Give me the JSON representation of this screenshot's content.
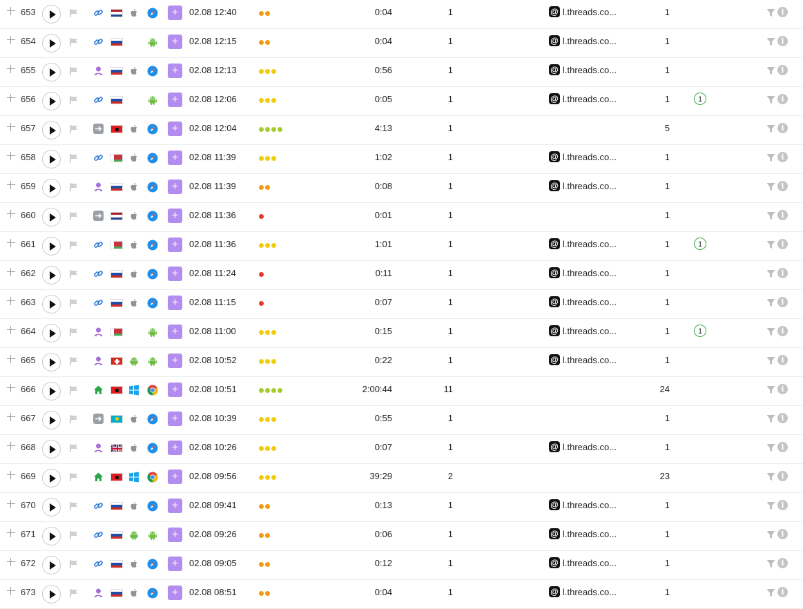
{
  "colors": {
    "accent": "#b28cf0",
    "link": "#2a78d6",
    "android": "#6ebc45",
    "green": "#3bab48"
  },
  "rows": [
    {
      "num": "653",
      "src": "link",
      "country": "nl",
      "os": "apple",
      "browser": "safari",
      "datetime": "02.08 12:40",
      "dots": [
        "orange",
        "orange"
      ],
      "duration": "0:04",
      "pages": "1",
      "referrer": "l.threads.co...",
      "events": "1",
      "badge": ""
    },
    {
      "num": "654",
      "src": "link",
      "country": "ru",
      "os": "none",
      "browser": "android",
      "datetime": "02.08 12:15",
      "dots": [
        "orange",
        "orange"
      ],
      "duration": "0:04",
      "pages": "1",
      "referrer": "l.threads.co...",
      "events": "1",
      "badge": ""
    },
    {
      "num": "655",
      "src": "user",
      "country": "ru",
      "os": "apple",
      "browser": "safari",
      "datetime": "02.08 12:13",
      "dots": [
        "yellow",
        "yellow",
        "yellow"
      ],
      "duration": "0:56",
      "pages": "1",
      "referrer": "l.threads.co...",
      "events": "1",
      "badge": ""
    },
    {
      "num": "656",
      "src": "link",
      "country": "ru",
      "os": "none",
      "browser": "android",
      "datetime": "02.08 12:06",
      "dots": [
        "yellow",
        "yellow",
        "yellow"
      ],
      "duration": "0:05",
      "pages": "1",
      "referrer": "l.threads.co...",
      "events": "1",
      "badge": "1"
    },
    {
      "num": "657",
      "src": "arrow",
      "country": "al",
      "os": "apple",
      "browser": "safari",
      "datetime": "02.08 12:04",
      "dots": [
        "lime",
        "lime",
        "lime",
        "lime"
      ],
      "duration": "4:13",
      "pages": "1",
      "referrer": "",
      "events": "5",
      "badge": ""
    },
    {
      "num": "658",
      "src": "link",
      "country": "by",
      "os": "apple",
      "browser": "safari",
      "datetime": "02.08 11:39",
      "dots": [
        "yellow",
        "yellow",
        "yellow"
      ],
      "duration": "1:02",
      "pages": "1",
      "referrer": "l.threads.co...",
      "events": "1",
      "badge": ""
    },
    {
      "num": "659",
      "src": "user",
      "country": "ru",
      "os": "apple",
      "browser": "safari",
      "datetime": "02.08 11:39",
      "dots": [
        "orange",
        "orange"
      ],
      "duration": "0:08",
      "pages": "1",
      "referrer": "l.threads.co...",
      "events": "1",
      "badge": ""
    },
    {
      "num": "660",
      "src": "arrow",
      "country": "nl",
      "os": "apple",
      "browser": "safari",
      "datetime": "02.08 11:36",
      "dots": [
        "red"
      ],
      "duration": "0:01",
      "pages": "1",
      "referrer": "",
      "events": "1",
      "badge": ""
    },
    {
      "num": "661",
      "src": "link",
      "country": "by",
      "os": "apple",
      "browser": "safari",
      "datetime": "02.08 11:36",
      "dots": [
        "yellow",
        "yellow",
        "yellow"
      ],
      "duration": "1:01",
      "pages": "1",
      "referrer": "l.threads.co...",
      "events": "1",
      "badge": "1"
    },
    {
      "num": "662",
      "src": "link",
      "country": "ru",
      "os": "apple",
      "browser": "safari",
      "datetime": "02.08 11:24",
      "dots": [
        "red"
      ],
      "duration": "0:11",
      "pages": "1",
      "referrer": "l.threads.co...",
      "events": "1",
      "badge": ""
    },
    {
      "num": "663",
      "src": "link",
      "country": "ru",
      "os": "apple",
      "browser": "safari",
      "datetime": "02.08 11:15",
      "dots": [
        "red"
      ],
      "duration": "0:07",
      "pages": "1",
      "referrer": "l.threads.co...",
      "events": "1",
      "badge": ""
    },
    {
      "num": "664",
      "src": "user",
      "country": "by",
      "os": "none",
      "browser": "android",
      "datetime": "02.08 11:00",
      "dots": [
        "yellow",
        "yellow",
        "yellow"
      ],
      "duration": "0:15",
      "pages": "1",
      "referrer": "l.threads.co...",
      "events": "1",
      "badge": "1"
    },
    {
      "num": "665",
      "src": "user",
      "country": "ch",
      "os": "android",
      "browser": "android",
      "datetime": "02.08 10:52",
      "dots": [
        "yellow",
        "yellow",
        "yellow"
      ],
      "duration": "0:22",
      "pages": "1",
      "referrer": "l.threads.co...",
      "events": "1",
      "badge": ""
    },
    {
      "num": "666",
      "src": "home",
      "country": "al",
      "os": "windows",
      "browser": "chrome",
      "datetime": "02.08 10:51",
      "dots": [
        "lime",
        "lime",
        "lime",
        "lime"
      ],
      "duration": "2:00:44",
      "pages": "11",
      "referrer": "",
      "events": "24",
      "badge": ""
    },
    {
      "num": "667",
      "src": "arrow",
      "country": "kz",
      "os": "apple",
      "browser": "safari",
      "datetime": "02.08 10:39",
      "dots": [
        "yellow",
        "yellow",
        "yellow"
      ],
      "duration": "0:55",
      "pages": "1",
      "referrer": "",
      "events": "1",
      "badge": ""
    },
    {
      "num": "668",
      "src": "user",
      "country": "gb",
      "os": "apple",
      "browser": "safari",
      "datetime": "02.08 10:26",
      "dots": [
        "yellow",
        "yellow",
        "yellow"
      ],
      "duration": "0:07",
      "pages": "1",
      "referrer": "l.threads.co...",
      "events": "1",
      "badge": ""
    },
    {
      "num": "669",
      "src": "home",
      "country": "al",
      "os": "windows",
      "browser": "chrome",
      "datetime": "02.08 09:56",
      "dots": [
        "yellow",
        "yellow",
        "yellow"
      ],
      "duration": "39:29",
      "pages": "2",
      "referrer": "",
      "events": "23",
      "badge": ""
    },
    {
      "num": "670",
      "src": "link",
      "country": "ru",
      "os": "apple",
      "browser": "safari",
      "datetime": "02.08 09:41",
      "dots": [
        "orange",
        "orange"
      ],
      "duration": "0:13",
      "pages": "1",
      "referrer": "l.threads.co...",
      "events": "1",
      "badge": ""
    },
    {
      "num": "671",
      "src": "link",
      "country": "ru",
      "os": "android",
      "browser": "android",
      "datetime": "02.08 09:26",
      "dots": [
        "orange",
        "orange"
      ],
      "duration": "0:06",
      "pages": "1",
      "referrer": "l.threads.co...",
      "events": "1",
      "badge": ""
    },
    {
      "num": "672",
      "src": "link",
      "country": "ru",
      "os": "apple",
      "browser": "safari",
      "datetime": "02.08 09:05",
      "dots": [
        "orange",
        "orange"
      ],
      "duration": "0:12",
      "pages": "1",
      "referrer": "l.threads.co...",
      "events": "1",
      "badge": ""
    },
    {
      "num": "673",
      "src": "user",
      "country": "ru",
      "os": "apple",
      "browser": "safari",
      "datetime": "02.08 08:51",
      "dots": [
        "orange",
        "orange"
      ],
      "duration": "0:04",
      "pages": "1",
      "referrer": "l.threads.co...",
      "events": "1",
      "badge": ""
    }
  ]
}
